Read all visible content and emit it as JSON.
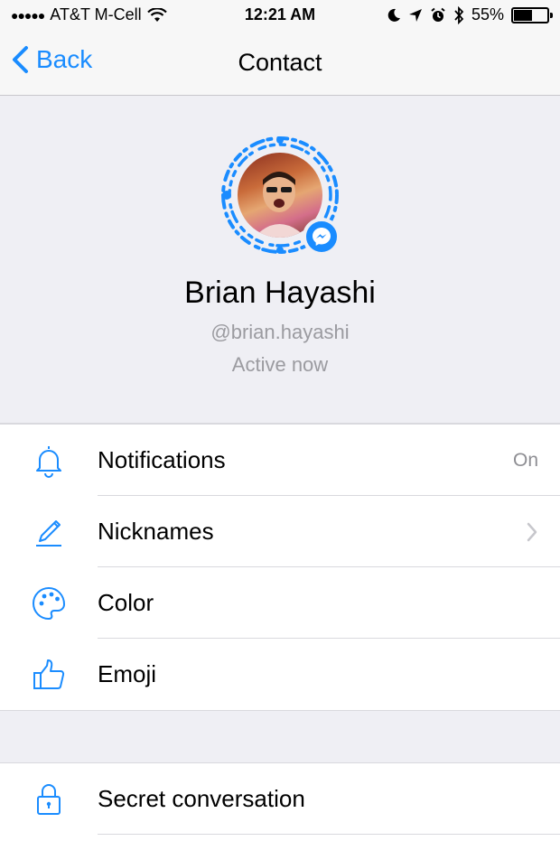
{
  "status_bar": {
    "carrier": "AT&T M-Cell",
    "time": "12:21 AM",
    "battery": "55%",
    "battery_level": 0.55,
    "icons": [
      "signal-dots-icon",
      "wifi-icon",
      "moon-icon",
      "location-arrow-icon",
      "alarm-icon",
      "bluetooth-icon",
      "battery-icon"
    ]
  },
  "nav": {
    "back_label": "Back",
    "title": "Contact"
  },
  "profile": {
    "name": "Brian Hayashi",
    "username": "@brian.hayashi",
    "status": "Active now"
  },
  "settings": [
    {
      "id": "notifications",
      "icon": "bell-icon",
      "label": "Notifications",
      "value": "On"
    },
    {
      "id": "nicknames",
      "icon": "pencil-icon",
      "label": "Nicknames",
      "value": ""
    },
    {
      "id": "color",
      "icon": "palette-icon",
      "label": "Color",
      "value": ""
    },
    {
      "id": "emoji",
      "icon": "thumbs-up-icon",
      "label": "Emoji",
      "value": ""
    }
  ],
  "secret": {
    "icon": "lock-icon",
    "label": "Secret conversation"
  },
  "colors": {
    "accent": "#1a8cff",
    "background": "#efeff4",
    "secondary_text": "#9b9ba0"
  }
}
